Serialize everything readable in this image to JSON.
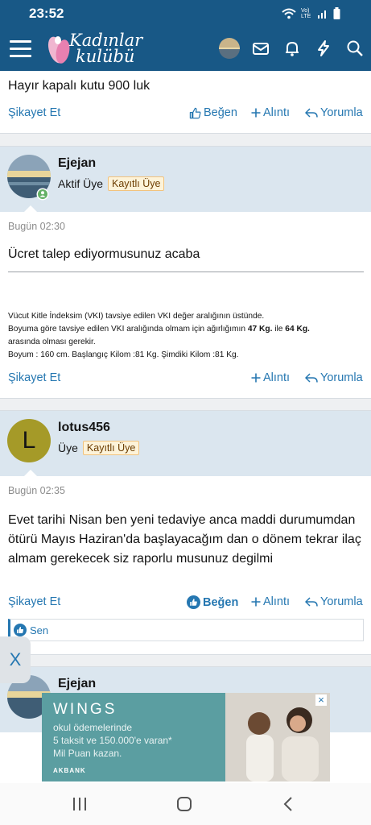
{
  "status": {
    "time": "23:52",
    "network_label": "Vo) LTE"
  },
  "header": {
    "logo_text_line1": "Kadınlar",
    "logo_text_line2": "kulübü"
  },
  "post1": {
    "message": "Hayır kapalı kutu 900 luk",
    "report": "Şikayet Et",
    "like": "Beğen",
    "quote": "Alıntı",
    "reply": "Yorumla"
  },
  "post2": {
    "username": "Ejejan",
    "role": "Aktif Üye",
    "badge": "Kayıtlı Üye",
    "date": "Bugün 02:30",
    "message": "Ücret talep ediyormusunuz acaba",
    "sig_line1": "Vücut Kitle İndeksim (VKI) tavsiye edilen VKI değer aralığının üstünde.",
    "sig_line2_a": "Boyuma göre tavsiye edilen VKI aralığında olmam için ağırlığımın ",
    "sig_line2_b": "47 Kg.",
    "sig_line2_c": " ile ",
    "sig_line2_d": "64 Kg.",
    "sig_line3": "arasında olması gerekir.",
    "sig_line4": "Boyum : 160 cm. Başlangıç Kilom :81 Kg. Şimdiki Kilom :81 Kg.",
    "report": "Şikayet Et",
    "quote": "Alıntı",
    "reply": "Yorumla"
  },
  "post3": {
    "avatar_letter": "L",
    "username": "lotus456",
    "role": "Üye",
    "badge": "Kayıtlı Üye",
    "date": "Bugün 02:35",
    "message": "Evet tarihi Nisan ben yeni tedaviye anca maddi durumumdan ötürü Mayıs Haziran'da başlayacağım dan o dönem tekrar ilaç almam gerekecek siz raporlu musunuz degilmi",
    "report": "Şikayet Et",
    "like": "Beğen",
    "quote": "Alıntı",
    "reply": "Yorumla",
    "reaction_by": "Sen"
  },
  "post4": {
    "username": "Ejejan"
  },
  "ad": {
    "close_label": "X",
    "brand": "WINGS",
    "line1": "okul ödemelerinde",
    "line2": "5 taksit ve 150.000'e varan*",
    "line3": "Mil Puan kazan.",
    "bank": "AKBANK"
  },
  "colors": {
    "header_bg": "#185886",
    "link": "#2577b1",
    "author_bg": "#dbe6ef",
    "badge_bg": "#fdf3d9"
  }
}
